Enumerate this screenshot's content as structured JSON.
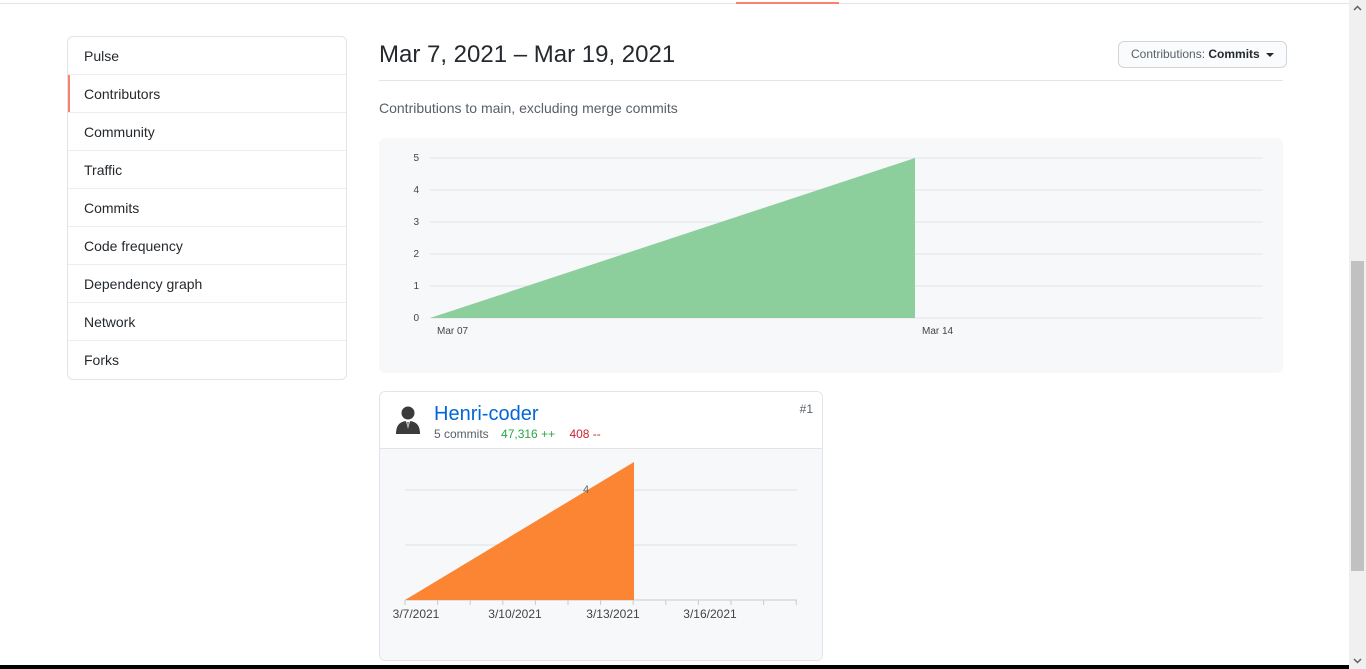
{
  "sidebar": {
    "items": [
      {
        "label": "Pulse"
      },
      {
        "label": "Contributors",
        "selected": true
      },
      {
        "label": "Community"
      },
      {
        "label": "Traffic"
      },
      {
        "label": "Commits"
      },
      {
        "label": "Code frequency"
      },
      {
        "label": "Dependency graph"
      },
      {
        "label": "Network"
      },
      {
        "label": "Forks"
      }
    ]
  },
  "header": {
    "date_range": "Mar 7, 2021 – Mar 19, 2021",
    "contributions_label": "Contributions:",
    "contributions_value": "Commits",
    "subtitle": "Contributions to main, excluding merge commits"
  },
  "contributor": {
    "name": "Henri-coder",
    "commits": "5 commits",
    "additions": "47,316 ++",
    "deletions": "408 --",
    "rank": "#1"
  },
  "colors": {
    "main_area": "#8ccf9d",
    "contributor_area": "#fb8532",
    "accent": "#f9826c",
    "link": "#0366d6"
  },
  "chart_data": [
    {
      "type": "area",
      "x": [
        "2021-03-07",
        "2021-03-14"
      ],
      "y": [
        0,
        5
      ],
      "x_tick_labels": [
        "Mar 07",
        "Mar 14"
      ],
      "y_ticks": [
        0,
        1,
        2,
        3,
        4,
        5
      ],
      "ylim": [
        0,
        5
      ],
      "grid": true
    },
    {
      "type": "area",
      "x": [
        "2021-03-07",
        "2021-03-14"
      ],
      "y": [
        0,
        5
      ],
      "x_tick_labels": [
        "3/7/2021",
        "3/10/2021",
        "3/13/2021",
        "3/16/2021"
      ],
      "y_tick_labels": [
        "4"
      ],
      "grid": true
    }
  ]
}
